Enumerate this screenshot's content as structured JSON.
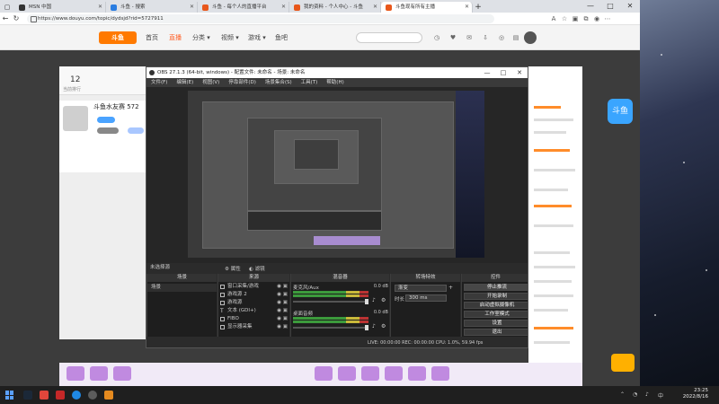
{
  "browser": {
    "tabs": [
      {
        "label": "MSN 中国",
        "active": false
      },
      {
        "label": "斗鱼 - 搜索",
        "active": false
      },
      {
        "label": "斗鱼 - 每个人的直播平台",
        "active": false
      },
      {
        "label": "我的资料 - 个人中心 - 斗鱼",
        "active": true
      },
      {
        "label": "斗鱼现有所有主播",
        "active": false
      }
    ],
    "new_tab": "+",
    "url": "https://www.douyu.com/topic/dydsjd?rid=5727911",
    "window_controls": [
      "—",
      "□",
      "✕"
    ]
  },
  "douyu": {
    "logo": "斗鱼",
    "nav": [
      "首页",
      "直播",
      "分类 ▾",
      "视频 ▾",
      "游戏 ▾",
      "鱼吧"
    ],
    "stat_number": "12",
    "stat_label": "当前排行",
    "room_title": "斗鱼水友赛 572",
    "side_badge": "斗鱼"
  },
  "obs": {
    "title": "OBS 27.1.3 (64-bit, windows) - 配置文件: 未命名 - 场景: 未命名",
    "menu": [
      "文件(F)",
      "编辑(E)",
      "视图(V)",
      "停靠部件(D)",
      "场景集合(S)",
      "工具(T)",
      "帮助(H)"
    ],
    "scene_label": "未选择源",
    "mic_btn": "属性",
    "filter_btn": "滤镜",
    "docks": {
      "scenes": {
        "header": "场景",
        "items": [
          "场景"
        ]
      },
      "sources": {
        "header": "来源",
        "items": [
          "窗口采集/游戏",
          "游戏源 2",
          "游戏源",
          "文本 (GDI+)",
          "FIBO",
          "显示器采集"
        ]
      },
      "mixer": {
        "header": "混音器",
        "rows": [
          {
            "name": "麦克风/Aux",
            "db": "0.0 dB"
          },
          {
            "name": "桌面音频",
            "db": "0.0 dB"
          }
        ]
      },
      "transitions": {
        "header": "转场特效",
        "mode": "渐变",
        "duration_label": "时长",
        "duration": "300 ms"
      },
      "controls": {
        "header": "控件",
        "buttons": [
          "停止推流",
          "开始录制",
          "启动虚拟摄像机",
          "工作室模式",
          "设置",
          "退出"
        ]
      }
    },
    "footer_icons": "+ − ⌃ ⌄",
    "status": "LIVE: 00:00:00   REC: 00:00:00   CPU: 1.0%, 59.94 fps"
  },
  "taskbar": {
    "time": "23:25",
    "date": "2022/8/16"
  }
}
